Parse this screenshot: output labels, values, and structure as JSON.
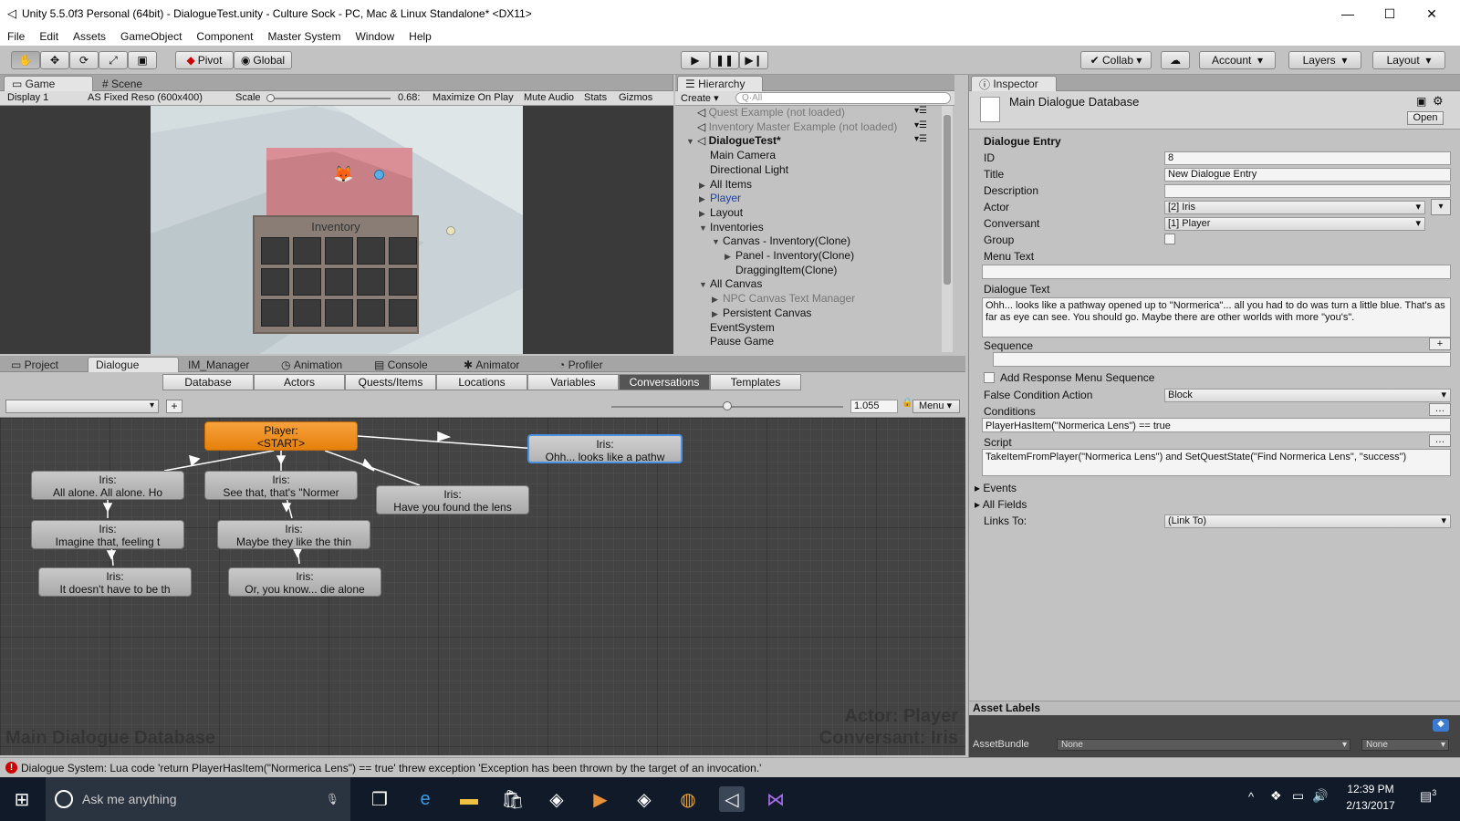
{
  "window": {
    "title": "Unity 5.5.0f3 Personal (64bit) - DialogueTest.unity - Culture Sock - PC, Mac & Linux Standalone* <DX11>",
    "menu": [
      "File",
      "Edit",
      "Assets",
      "GameObject",
      "Component",
      "Master System",
      "Window",
      "Help"
    ]
  },
  "toolbar": {
    "pivot": "Pivot",
    "global": "Global",
    "collab": "Collab",
    "account": "Account",
    "layers": "Layers",
    "layout": "Layout"
  },
  "game_panel": {
    "tabs": [
      "Game",
      "Scene"
    ],
    "display": "Display 1",
    "resolution": "AS Fixed Reso (600x400)",
    "scale_label": "Scale",
    "scale_value": "0.68:",
    "maximize": "Maximize On Play",
    "mute": "Mute Audio",
    "stats": "Stats",
    "gizmos": "Gizmos",
    "inventory_title": "Inventory"
  },
  "hierarchy": {
    "tab": "Hierarchy",
    "create": "Create",
    "search_placeholder": "Q·All",
    "items": [
      {
        "label": "Quest Example (not loaded)",
        "indent": 0,
        "state": "unloaded",
        "arrow": "",
        "icon": true
      },
      {
        "label": "Inventory Master Example (not loaded)",
        "indent": 0,
        "state": "unloaded",
        "arrow": "",
        "icon": true
      },
      {
        "label": "DialogueTest*",
        "indent": 0,
        "state": "scene",
        "arrow": "▼",
        "icon": true
      },
      {
        "label": "Main Camera",
        "indent": 1,
        "state": "normal",
        "arrow": ""
      },
      {
        "label": "Directional Light",
        "indent": 1,
        "state": "normal",
        "arrow": ""
      },
      {
        "label": "All Items",
        "indent": 1,
        "state": "normal",
        "arrow": "▶"
      },
      {
        "label": "Player",
        "indent": 1,
        "state": "prefab",
        "arrow": "▶"
      },
      {
        "label": "Layout",
        "indent": 1,
        "state": "normal",
        "arrow": "▶"
      },
      {
        "label": "Inventories",
        "indent": 1,
        "state": "normal",
        "arrow": "▼"
      },
      {
        "label": "Canvas - Inventory(Clone)",
        "indent": 2,
        "state": "normal",
        "arrow": "▼"
      },
      {
        "label": "Panel - Inventory(Clone)",
        "indent": 3,
        "state": "normal",
        "arrow": "▶"
      },
      {
        "label": "DraggingItem(Clone)",
        "indent": 3,
        "state": "normal",
        "arrow": ""
      },
      {
        "label": "All Canvas",
        "indent": 1,
        "state": "normal",
        "arrow": "▼"
      },
      {
        "label": "NPC Canvas Text Manager",
        "indent": 2,
        "state": "disabled",
        "arrow": "▶"
      },
      {
        "label": "Persistent Canvas",
        "indent": 2,
        "state": "normal",
        "arrow": "▶"
      },
      {
        "label": "EventSystem",
        "indent": 1,
        "state": "normal",
        "arrow": ""
      },
      {
        "label": "Pause Game",
        "indent": 1,
        "state": "normal",
        "arrow": ""
      }
    ]
  },
  "bottom_tabs": [
    "Project",
    "Dialogue",
    "IM_Manager",
    "Animation",
    "Console",
    "Animator",
    "Profiler"
  ],
  "dialogue": {
    "subtabs": [
      "Database",
      "Actors",
      "Quests/Items",
      "Locations",
      "Variables",
      "Conversations",
      "Templates"
    ],
    "selected_subtab": "Conversations",
    "zoom": "1.055",
    "menu": "Menu",
    "nodes": {
      "start": {
        "l1": "Player:",
        "l2": "<START>"
      },
      "n1": {
        "l1": "Iris:",
        "l2": "All alone. All alone. Ho"
      },
      "n2": {
        "l1": "Iris:",
        "l2": "See that, that's \"Normer"
      },
      "n3": {
        "l1": "Iris:",
        "l2": "Have you found the lens"
      },
      "n4": {
        "l1": "Iris:",
        "l2": "Ohh... looks like a pathw"
      },
      "n5": {
        "l1": "Iris:",
        "l2": "Imagine that, feeling t"
      },
      "n6": {
        "l1": "Iris:",
        "l2": "Maybe they like the thin"
      },
      "n7": {
        "l1": "Iris:",
        "l2": "It doesn't have to be th"
      },
      "n8": {
        "l1": "Iris:",
        "l2": "Or, you know... die alone"
      }
    },
    "watermark_db": "Main Dialogue Database",
    "watermark_actor": "Actor: Player",
    "watermark_conversant": "Conversant: Iris"
  },
  "inspector": {
    "tab": "Inspector",
    "asset_name": "Main Dialogue Database",
    "open": "Open",
    "section": "Dialogue Entry",
    "fields": {
      "id_label": "ID",
      "id": "8",
      "title_label": "Title",
      "title": "New Dialogue Entry",
      "description_label": "Description",
      "description": "",
      "actor_label": "Actor",
      "actor": "[2] Iris",
      "conversant_label": "Conversant",
      "conversant": "[1] Player",
      "group_label": "Group",
      "menu_text_label": "Menu Text",
      "menu_text": "",
      "dialogue_text_label": "Dialogue Text",
      "dialogue_text": "Ohh... looks like a pathway opened up to \"Normerica\"... all you had to do was turn a little blue. That's as far as eye can see. You should go. Maybe there are other worlds with more \"you's\".",
      "sequence_label": "Sequence",
      "add_response": "Add Response Menu Sequence",
      "false_cond_label": "False Condition Action",
      "false_cond": "Block",
      "conditions_label": "Conditions",
      "conditions": "PlayerHasItem(\"Normerica Lens\") == true",
      "script_label": "Script",
      "script": "TakeItemFromPlayer(\"Normerica Lens\") and SetQuestState(\"Find Normerica Lens\", \"success\")",
      "events": "Events",
      "all_fields": "All Fields",
      "links_label": "Links To:",
      "links": "(Link To)"
    },
    "asset_labels": "Asset Labels",
    "assetbundle_label": "AssetBundle",
    "assetbundle": "None",
    "variant": "None"
  },
  "status": {
    "message": "Dialogue System: Lua code 'return PlayerHasItem(\"Normerica Lens\") == true' threw exception 'Exception has been thrown by the target of an invocation.'"
  },
  "taskbar": {
    "search": "Ask me anything",
    "time": "12:39 PM",
    "date": "2/13/2017",
    "notif": "3"
  },
  "colors": {
    "accent": "#4a90e2",
    "start_node": "#f29426",
    "error": "#cc0000"
  }
}
